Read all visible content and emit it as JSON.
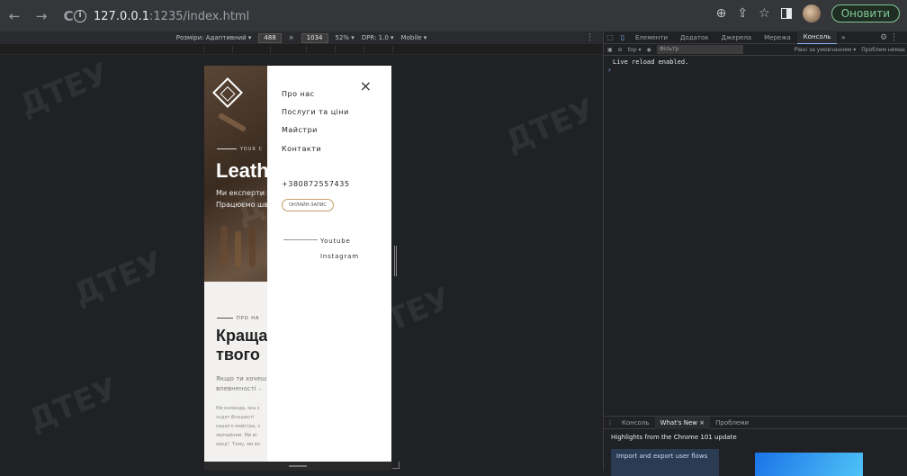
{
  "browser": {
    "url_host": "127.0.0.1",
    "url_path": ":1235/index.html",
    "update_label": "Оновити"
  },
  "device_toolbar": {
    "dimensions_label": "Розміри: Адаптивний",
    "width": "488",
    "height": "1034",
    "zoom": "52%",
    "dpr": "DPR: 1.0",
    "mode": "Mobile"
  },
  "page": {
    "hero_kicker": "YOUR C",
    "hero_title": "Leath",
    "hero_text_1": "Ми експерти в",
    "hero_text_2": "Працюємо шв",
    "about_kicker": "ПРО НА",
    "about_title_1": "Краща",
    "about_title_2": "твого",
    "about_text_1": "Якщо ти хочеш",
    "about_text_2": "впевненості –",
    "about_small_1": "Ми команда, яка з",
    "about_small_2": "ходят більшості",
    "about_small_3": "нашого майстра, з",
    "about_small_4": "звичайним. Ми ві",
    "about_small_5": "хенд\". Тому, ми во"
  },
  "menu": {
    "items": [
      "Про нас",
      "Послуги та ціни",
      "Майстри",
      "Контакти"
    ],
    "phone": "+380872557435",
    "book_label": "ОНЛАЙН-ЗАПИС",
    "social": [
      "Youtube",
      "Instagram"
    ],
    "close_icon": "×"
  },
  "devtools": {
    "tabs": [
      "Елементи",
      "Додаток",
      "Джерела",
      "Мережа",
      "Консоль"
    ],
    "active_tab": "Консоль",
    "context": "top",
    "filter_placeholder": "Фільтр",
    "levels": "Рівні за умовчанням",
    "issues": "Проблем немає",
    "console_message": "Live reload enabled.",
    "drawer_tabs": [
      "Консоль",
      "What's New",
      "Проблеми"
    ],
    "highlights": "Highlights from the Chrome 101 update",
    "card_title": "Import and export user flows"
  },
  "watermark": "ДТЕУ"
}
